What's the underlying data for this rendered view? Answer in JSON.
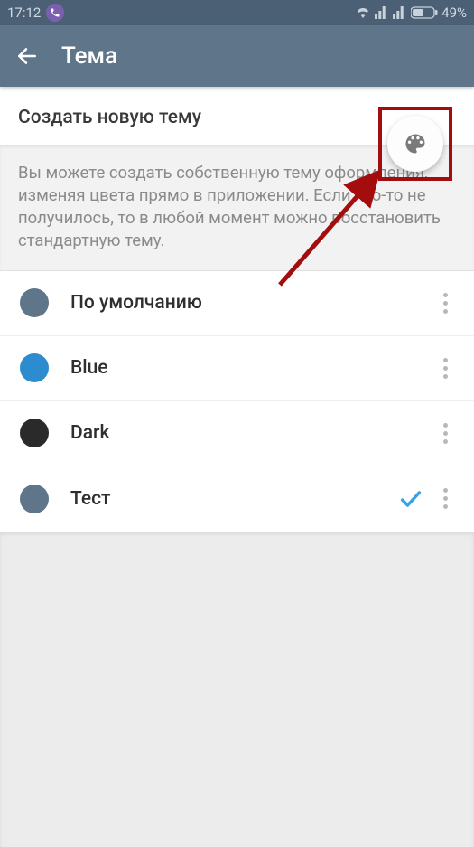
{
  "status_bar": {
    "time": "17:12",
    "battery": "49%"
  },
  "header": {
    "title": "Тема"
  },
  "create_section": {
    "title": "Создать новую тему"
  },
  "description": {
    "text": "Вы можете создать собственную тему оформления, изменяя цвета прямо в приложении. Если что-то не получилось, то в любой момент можно восстановить стандартную тему."
  },
  "themes": [
    {
      "name": "По умолчанию",
      "color": "#5f7589",
      "selected": false
    },
    {
      "name": "Blue",
      "color": "#2d8bd0",
      "selected": false
    },
    {
      "name": "Dark",
      "color": "#2a2a2a",
      "selected": false
    },
    {
      "name": "Тест",
      "color": "#5f7589",
      "selected": true
    }
  ],
  "annotation": {
    "highlight_color": "#a30d0d"
  }
}
